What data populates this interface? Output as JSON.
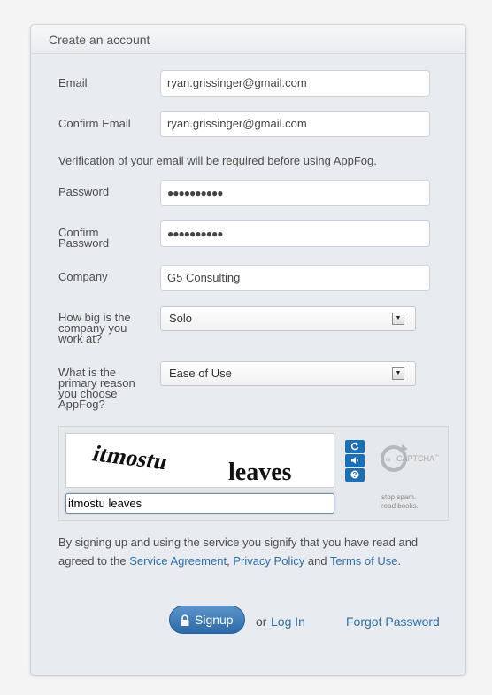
{
  "header": {
    "title": "Create an account"
  },
  "form": {
    "email": {
      "label": "Email",
      "value": "ryan.grissinger@gmail.com"
    },
    "confirm_email": {
      "label": "Confirm Email",
      "value": "ryan.grissinger@gmail.com"
    },
    "verification_note": "Verification of your email will be required before using AppFog.",
    "password": {
      "label": "Password",
      "value": "●●●●●●●●●●"
    },
    "confirm_password": {
      "label_line1": "Confirm",
      "label_line2": "Password",
      "value": "●●●●●●●●●●"
    },
    "company": {
      "label": "Company",
      "value": "G5 Consulting"
    },
    "company_size": {
      "label_line1": "How big is the",
      "label_line2": "company you",
      "label_line3": "work at?",
      "selected": "Solo"
    },
    "reason": {
      "label_line1": "What is the",
      "label_line2": "primary reason",
      "label_line3": "you choose",
      "label_line4": "AppFog?",
      "selected": "Ease of Use"
    }
  },
  "captcha": {
    "word1": "itmostu",
    "word2": "leaves",
    "response": "itmostu leaves",
    "refresh_icon": "refresh-icon",
    "audio_icon": "audio-icon",
    "help_icon": "help-icon",
    "logo_re": "re",
    "logo_text": "CAPTCHA",
    "logo_tm": "™",
    "tagline_line1": "stop spam.",
    "tagline_line2": "read books."
  },
  "terms": {
    "prefix": "By signing up and using the service you signify that you have read and agreed to the ",
    "service_agreement": "Service Agreement",
    "comma": ", ",
    "privacy_policy": "Privacy Policy",
    "and": " and ",
    "terms_of_use": "Terms of Use",
    "period": "."
  },
  "actions": {
    "signup_label": "Signup",
    "or_text": "or",
    "login_label": "Log In",
    "forgot_label": "Forgot Password"
  },
  "colors": {
    "accent": "#2f6ea8",
    "button": "#3a78b5"
  }
}
